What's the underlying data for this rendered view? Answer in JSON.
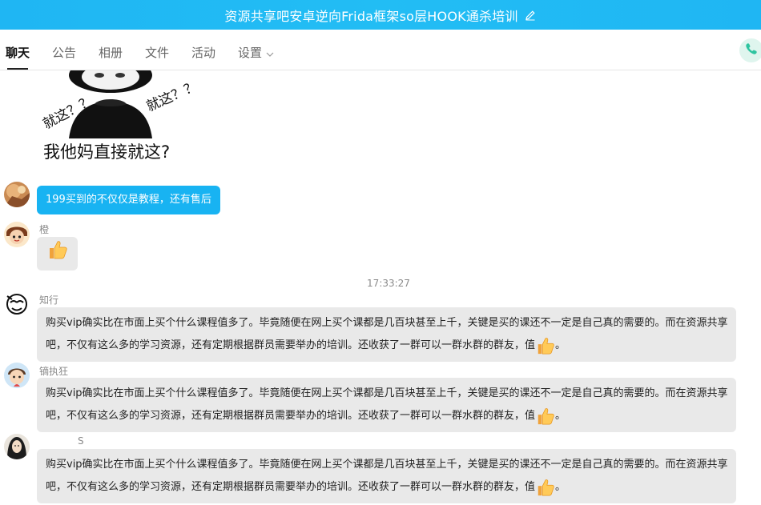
{
  "window": {
    "title": "资源共享吧安卓逆向Frida框架so层HOOK通杀培训"
  },
  "tabs": [
    {
      "label": "聊天",
      "active": true
    },
    {
      "label": "公告",
      "active": false
    },
    {
      "label": "相册",
      "active": false
    },
    {
      "label": "文件",
      "active": false
    },
    {
      "label": "活动",
      "active": false
    },
    {
      "label": "设置",
      "active": false
    }
  ],
  "meme": {
    "caption": "我他妈直接就这?",
    "left_text": "就这？？",
    "right_text": "就这？？"
  },
  "messages": [
    {
      "sender": "",
      "text": "199买到的不仅仅是教程，还有售后",
      "style": "blue"
    },
    {
      "sender": "橙",
      "text": "",
      "emoji": "thumbs-up"
    },
    {
      "timestamp": "17:33:27"
    },
    {
      "sender": "知行",
      "line1": "购买vip确实比在市面上买个什么课程值多了。毕竟随便在网上买个课都是几百块甚至上千，关键是买的课还不一定是自己真的需要的。而在资源共享",
      "line2": "吧，不仅有这么多的学习资源，还有定期根据群员需要举办的培训。还收获了一群可以一群水群的群友，值",
      "tail": "。"
    },
    {
      "sender": "镝执狂",
      "line1": "购买vip确实比在市面上买个什么课程值多了。毕竟随便在网上买个课都是几百块甚至上千，关键是买的课还不一定是自己真的需要的。而在资源共享",
      "line2": "吧，不仅有这么多的学习资源，还有定期根据群员需要举办的培训。还收获了一群可以一群水群的群友，值",
      "tail": "。"
    },
    {
      "sender": "S",
      "line1": "购买vip确实比在市面上买个什么课程值多了。毕竟随便在网上买个课都是几百块甚至上千，关键是买的课还不一定是自己真的需要的。而在资源共享",
      "line2": "吧，不仅有这么多的学习资源，还有定期根据群员需要举办的培训。还收获了一群可以一群水群的群友，值",
      "tail": "。"
    }
  ],
  "colors": {
    "title_bar": "#1fb6f3",
    "blue_bubble": "#18b3f2",
    "gray_bubble": "#e9e9e9",
    "phone_icon": "#2ec4a0"
  }
}
